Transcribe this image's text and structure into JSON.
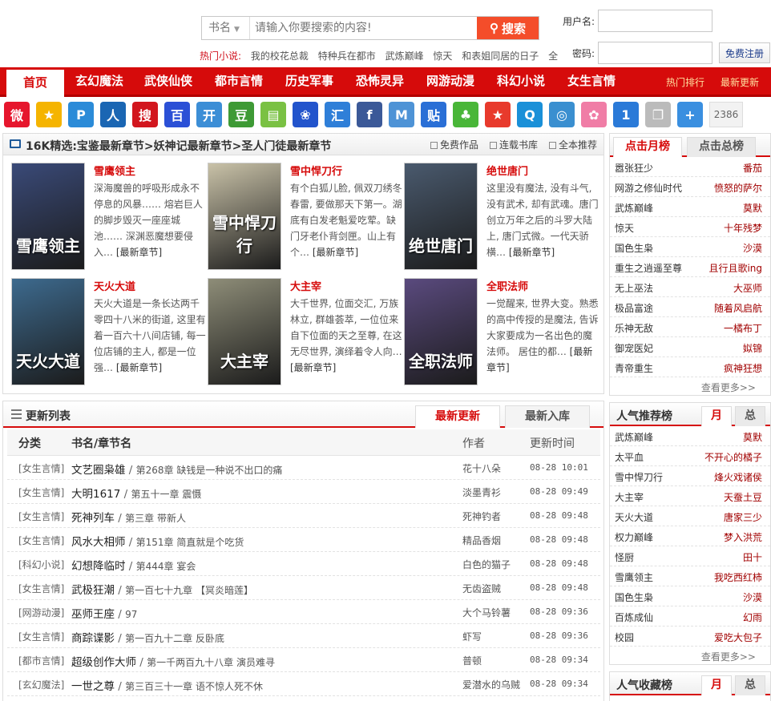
{
  "search": {
    "type": "书名",
    "placeholder": "请输入你要搜索的内容!",
    "button": "搜索",
    "hot_label": "热门小说:",
    "hot": [
      "我的校花总裁",
      "特种兵在都市",
      "武炼巅峰",
      "惊天",
      "和表姐同居的日子",
      "全"
    ]
  },
  "login": {
    "user_label": "用户名:",
    "pass_label": "密码:",
    "register": "免费注册"
  },
  "nav": {
    "items": [
      "首页",
      "玄幻魔法",
      "武侠仙侠",
      "都市言情",
      "历史军事",
      "恐怖灵异",
      "网游动漫",
      "科幻小说",
      "女生言情"
    ],
    "right": [
      "热门排行",
      "最新更新"
    ]
  },
  "share": {
    "icons": [
      {
        "name": "weibo-icon",
        "color": "#e6162d",
        "glyph": "微"
      },
      {
        "name": "qzone-icon",
        "color": "#f5b400",
        "glyph": "★"
      },
      {
        "name": "pengyou-icon",
        "color": "#2b8bd8",
        "glyph": "P"
      },
      {
        "name": "renren-icon",
        "color": "#1a66b3",
        "glyph": "人"
      },
      {
        "name": "sohu-icon",
        "color": "#d2161e",
        "glyph": "搜"
      },
      {
        "name": "baidu-icon",
        "color": "#2b50d6",
        "glyph": "百"
      },
      {
        "name": "kaixin-icon",
        "color": "#3c8ed6",
        "glyph": "开"
      },
      {
        "name": "douban-icon",
        "color": "#3e9a35",
        "glyph": "豆"
      },
      {
        "name": "bookmark-icon",
        "color": "#7ac143",
        "glyph": "▤"
      },
      {
        "name": "baidu-paw-icon",
        "color": "#2254cc",
        "glyph": "❀"
      },
      {
        "name": "huiren-icon",
        "color": "#2f7fd8",
        "glyph": "汇"
      },
      {
        "name": "facebook-icon",
        "color": "#3b5998",
        "glyph": "f"
      },
      {
        "name": "msn-icon",
        "color": "#4e93d6",
        "glyph": "M"
      },
      {
        "name": "tieba-icon",
        "color": "#2a6fd6",
        "glyph": "贴"
      },
      {
        "name": "clover-icon",
        "color": "#49b638",
        "glyph": "♣"
      },
      {
        "name": "star-icon",
        "color": "#e83a2c",
        "glyph": "★"
      },
      {
        "name": "qq-icon",
        "color": "#1a90d8",
        "glyph": "Q"
      },
      {
        "name": "circle-icon",
        "color": "#3a8fd0",
        "glyph": "◎"
      },
      {
        "name": "flower-icon",
        "color": "#f07da6",
        "glyph": "✿"
      },
      {
        "name": "one-icon",
        "color": "#2a7ad8",
        "glyph": "1"
      },
      {
        "name": "copy-icon",
        "color": "#bbbbbb",
        "glyph": "❐"
      },
      {
        "name": "plus-icon",
        "color": "#3a8fe0",
        "glyph": "+"
      }
    ],
    "count": "2386"
  },
  "featured": {
    "title": "16K精选:宝鉴最新章节>妖神记最新章节>圣人门徒最新章节",
    "links": [
      "免费作品",
      "连载书库",
      "全本推荐"
    ],
    "more_label": "[最新章节]",
    "books": [
      {
        "title": "雪鹰领主",
        "desc": "深海魔兽的呼吸形成永不停息的风暴…… 熔岩巨人的脚步毁灭一座座城池…… 深渊恶魔想要侵入…",
        "cover_text": "雪鹰领主",
        "cover_color": "#3a4a78"
      },
      {
        "title": "雪中悍刀行",
        "desc": "有个白狐儿脸, 佩双刀绣冬春雷, 要做那天下第一。湖底有白发老魁爱吃荤。缺门牙老仆背剑匣。山上有个…",
        "cover_text": "雪中悍刀行",
        "cover_color": "#c9c2a8"
      },
      {
        "title": "绝世唐门",
        "desc": "这里没有魔法, 没有斗气, 没有武术, 却有武魂。唐门创立万年之后的斗罗大陆上, 唐门式微。一代天骄横…",
        "cover_text": "绝世唐门",
        "cover_color": "#4a5a6e"
      },
      {
        "title": "天火大道",
        "desc": "天火大道是一条长达两千零四十八米的街道, 这里有着一百六十八间店铺, 每一位店铺的主人, 都是一位强…",
        "cover_text": "天火大道",
        "cover_color": "#3d6a8e"
      },
      {
        "title": "大主宰",
        "desc": "大千世界, 位面交汇, 万族林立, 群雄荟萃, 一位位来自下位面的天之至尊, 在这无尽世界, 演绎着令人向…",
        "cover_text": "大主宰",
        "cover_color": "#8e8d78"
      },
      {
        "title": "全职法师",
        "desc": "一觉醒来, 世界大变。熟悉的高中传授的是魔法, 告诉大家要成为一名出色的魔法师。 居住的都…",
        "cover_text": "全职法师",
        "cover_color": "#5a4a7e"
      }
    ]
  },
  "updates": {
    "title": "更新列表",
    "tabs": [
      "最新更新",
      "最新入库"
    ],
    "columns": [
      "分类",
      "书名/章节名",
      "作者",
      "更新时间"
    ],
    "rows": [
      {
        "cat": "[女生言情]",
        "name": "文艺圈枭雄",
        "chap": "第268章 缺钱是一种说不出口的痛",
        "author": "花十八朵",
        "time": "08-28 10:01"
      },
      {
        "cat": "[女生言情]",
        "name": "大明1617",
        "chap": "第五十一章 震慑",
        "author": "淡墨青衫",
        "time": "08-28 09:49"
      },
      {
        "cat": "[女生言情]",
        "name": "死神列车",
        "chap": "第三章 带新人",
        "author": "死神钓者",
        "time": "08-28 09:48"
      },
      {
        "cat": "[女生言情]",
        "name": "风水大相师",
        "chap": "第151章 简直就是个吃货",
        "author": "精品香烟",
        "time": "08-28 09:48"
      },
      {
        "cat": "[科幻小说]",
        "name": "幻想降临时",
        "chap": "第444章 宴会",
        "author": "白色的猫子",
        "time": "08-28 09:48"
      },
      {
        "cat": "[女生言情]",
        "name": "武极狂潮",
        "chap": "第一百七十九章 【冥炎暗莲】",
        "author": "无齿盗贼",
        "time": "08-28 09:48"
      },
      {
        "cat": "[网游动漫]",
        "name": "巫师王座",
        "chap": "97",
        "author": "大个马铃薯",
        "time": "08-28 09:36"
      },
      {
        "cat": "[女生言情]",
        "name": "商踪谍影",
        "chap": "第一百九十二章 反卧底",
        "author": "虾写",
        "time": "08-28 09:36"
      },
      {
        "cat": "[都市言情]",
        "name": "超级创作大师",
        "chap": "第一千两百九十八章 演员难寻",
        "author": "普顿",
        "time": "08-28 09:34"
      },
      {
        "cat": "[玄幻魔法]",
        "name": "一世之尊",
        "chap": "第三百三十一章 语不惊人死不休",
        "author": "爱潜水的乌贼",
        "time": "08-28 09:34"
      }
    ]
  },
  "click_rank": {
    "tabs": [
      "点击月榜",
      "点击总榜"
    ],
    "rows": [
      {
        "book": "嚣张狂少",
        "author": "番茄"
      },
      {
        "book": "网游之修仙时代",
        "author": "愤怒的萨尔"
      },
      {
        "book": "武炼巅峰",
        "author": "莫默"
      },
      {
        "book": "惊天",
        "author": "十年残梦"
      },
      {
        "book": "国色生枭",
        "author": "沙漠"
      },
      {
        "book": "重生之逍遥至尊",
        "author": "且行且歌ing"
      },
      {
        "book": "无上巫法",
        "author": "大巫师"
      },
      {
        "book": "极品富途",
        "author": "随着风启航"
      },
      {
        "book": "乐神无敌",
        "author": "一橘布丁"
      },
      {
        "book": "御宠医妃",
        "author": "姒锦"
      },
      {
        "book": "青帝重生",
        "author": "疯神狂想"
      }
    ],
    "more": "查看更多>>"
  },
  "popular_rank": {
    "title": "人气推荐榜",
    "tabs": [
      "月",
      "总"
    ],
    "rows": [
      {
        "book": "武炼巅峰",
        "author": "莫默"
      },
      {
        "book": "太平血",
        "author": "不开心的橘子"
      },
      {
        "book": "雪中悍刀行",
        "author": "烽火戏诸侯"
      },
      {
        "book": "大主宰",
        "author": "天蚕土豆"
      },
      {
        "book": "天火大道",
        "author": "唐家三少"
      },
      {
        "book": "权力巅峰",
        "author": "梦入洪荒"
      },
      {
        "book": "怪厨",
        "author": "田十"
      },
      {
        "book": "雪鹰领主",
        "author": "我吃西红柿"
      },
      {
        "book": "国色生枭",
        "author": "沙漠"
      },
      {
        "book": "百炼成仙",
        "author": "幻雨"
      },
      {
        "book": "校园",
        "author": "爱吃大包子"
      }
    ],
    "more": "查看更多>>"
  },
  "collect_rank": {
    "title": "人气收藏榜",
    "tabs": [
      "月",
      "总"
    ]
  }
}
